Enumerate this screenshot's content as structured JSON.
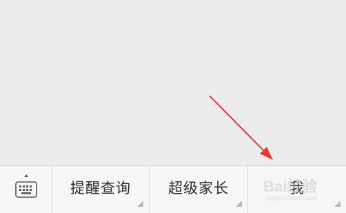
{
  "menu": {
    "keyboard_toggle_icon": "keyboard-icon",
    "items": [
      {
        "label": "提醒查询"
      },
      {
        "label": "超级家长"
      },
      {
        "label": "我"
      }
    ]
  },
  "annotation": {
    "arrow_color": "#e53935"
  },
  "watermark": {
    "brand": "Bai",
    "brand_cn": "经验",
    "url": "jingyan.baidu.com"
  }
}
